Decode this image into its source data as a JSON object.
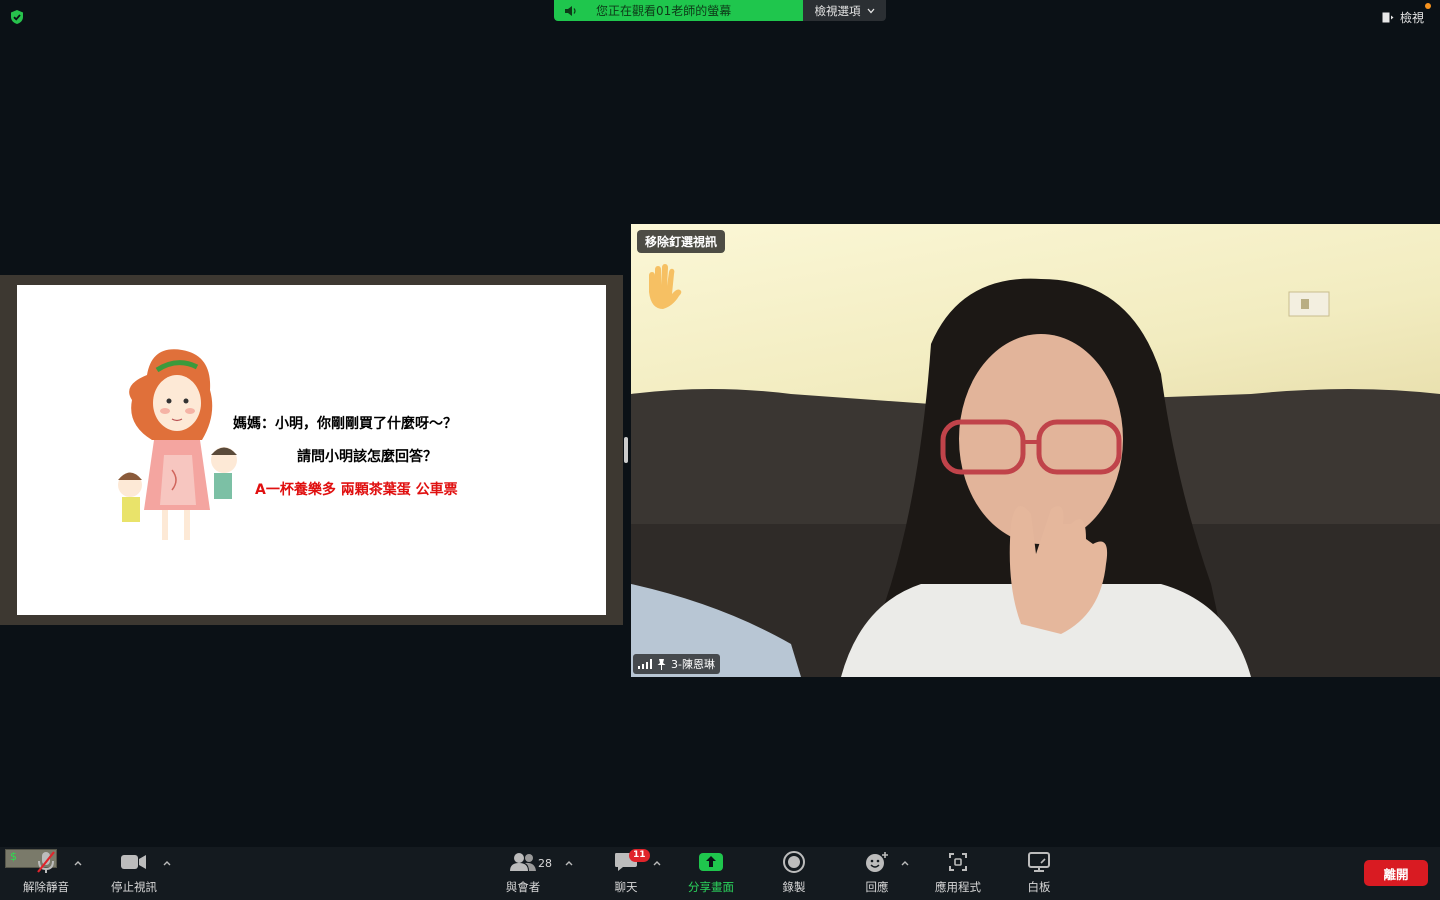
{
  "top_banner": {
    "text": "您正在觀看01老師的螢幕",
    "options_label": "檢視選項"
  },
  "view_button": {
    "label": "檢視"
  },
  "slide": {
    "line1": "媽媽：小明，你剛剛買了什麼呀～？",
    "line2": "請問小明該怎麼回答？",
    "line3": "A一杯養樂多 兩顆茶葉蛋 公車票"
  },
  "video": {
    "unpin_label": "移除釘選視訊",
    "participant_name": "3-陳恩琳"
  },
  "toolbar": {
    "unmute_label": "解除靜音",
    "stop_video_label": "停止視訊",
    "participants_label": "與會者",
    "participants_count": "28",
    "chat_label": "聊天",
    "chat_badge": "11",
    "share_label": "分享畫面",
    "record_label": "錄製",
    "reactions_label": "回應",
    "apps_label": "應用程式",
    "whiteboard_label": "白板",
    "leave_label": "離開",
    "audio_indicator": "$"
  },
  "colors": {
    "accent_green": "#1fc64d",
    "leave_red": "#d91b22",
    "badge_red": "#e0242b",
    "text_red": "#e01010"
  }
}
